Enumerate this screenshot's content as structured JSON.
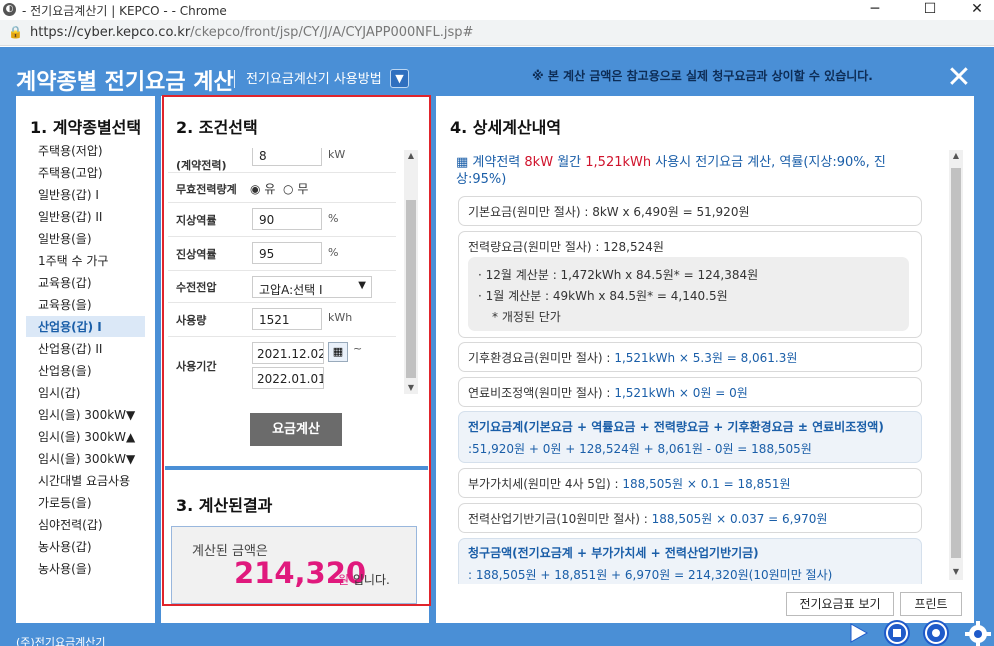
{
  "window": {
    "title": "- 전기요금계산기 | KEPCO - - Chrome",
    "url_host": "https://cyber.kepco.co.kr",
    "url_path": "/ckepco/front/jsp/CY/J/A/CYJAPP000NFL.jsp#"
  },
  "header": {
    "title": "계약종별 전기요금 계산",
    "howto_label": "전기요금계산기 사용방법",
    "notice": "※ 본 계산 금액은 참고용으로 실제 청구요금과 상이할 수 있습니다."
  },
  "contract": {
    "heading": "1. 계약종별선택",
    "items": [
      "주택용(저압)",
      "주택용(고압)",
      "일반용(갑) I",
      "일반용(갑) II",
      "일반용(을)",
      "1주택 수 가구",
      "교육용(갑)",
      "교육용(을)",
      "산업용(갑) I",
      "산업용(갑) II",
      "산업용(을)",
      "임시(갑)",
      "임시(을) 300kW▼",
      "임시(을) 300kW▲",
      "임시(을) 300kW▼",
      "시간대별 요금사용",
      "가로등(을)",
      "심야전력(갑)",
      "농사용(갑)",
      "농사용(을)"
    ],
    "selected_index": 8
  },
  "conditions": {
    "heading": "2. 조건선택",
    "contract_power_label": "(계약전력)",
    "contract_power_value": "8",
    "contract_power_unit": "kW",
    "reactive_label": "무효전력량계",
    "reactive_yes": "유",
    "reactive_no": "무",
    "lag_label": "지상역률",
    "lag_value": "90",
    "lag_unit": "%",
    "lead_label": "진상역률",
    "lead_value": "95",
    "lead_unit": "%",
    "voltage_label": "수전전압",
    "voltage_value": "고압A:선택 I",
    "usage_label": "사용량",
    "usage_value": "1521",
    "usage_unit": "kWh",
    "period_label": "사용기간",
    "period_from": "2021.12.02",
    "period_tilde": "~",
    "period_to": "2022.01.01",
    "calc_button": "요금계산"
  },
  "result": {
    "heading": "3. 계산된결과",
    "label": "계산된 금액은",
    "amount": "214,320",
    "unit": "원",
    "suffix": "입니다."
  },
  "detail": {
    "heading": "4. 상세계산내역",
    "summary_prefix": "▦ 계약전력",
    "summary_kw": "8kW",
    "summary_mid": "월간",
    "summary_kwh": "1,521kWh",
    "summary_rest": "사용시 전기요금 계산, 역률(지상:90%, 진상:95%)",
    "basic": "기본요금(원미만 절사) : 8kW x 6,490원 = 51,920원",
    "energy_title": "전력량요금(원미만 절사) : 128,524원",
    "energy_dec": "· 12월 계산분 : 1,472kWh x 84.5원* = 124,384원",
    "energy_jan": "· 1월 계산분 : 49kWh x 84.5원* = 4,140.5원",
    "energy_note": "* 개정된 단가",
    "climate_label": "기후환경요금(원미만 절사) :",
    "climate_value": "1,521kWh × 5.3원 = 8,061.3원",
    "fuel_label": "연료비조정액(원미만 절사) :",
    "fuel_value": "1,521kWh × 0원 = 0원",
    "subtotal_title": "전기요금계(기본요금 + 역률요금 + 전력량요금 + 기후환경요금 ± 연료비조정액)",
    "subtotal_value": ":51,920원 + 0원 + 128,524원 + 8,061원 - 0원 = 188,505원",
    "vat_label": "부가가치세(원미만 4사 5입) :",
    "vat_value": "188,505원 × 0.1 = 18,851원",
    "fund_label": "전력산업기반기금(10원미만 절사) :",
    "fund_value": "188,505원 × 0.037 = 6,970원",
    "total_title": "청구금액(전기요금계 + 부가가치세 + 전력산업기반기금)",
    "total_value": ": 188,505원 + 18,851원 + 6,970원 = 214,320원(10원미만 절사)",
    "tariff_button": "전기요금표 보기",
    "print_button": "프린트"
  },
  "taskbar": {
    "text": "(주)전기요금계산기"
  }
}
